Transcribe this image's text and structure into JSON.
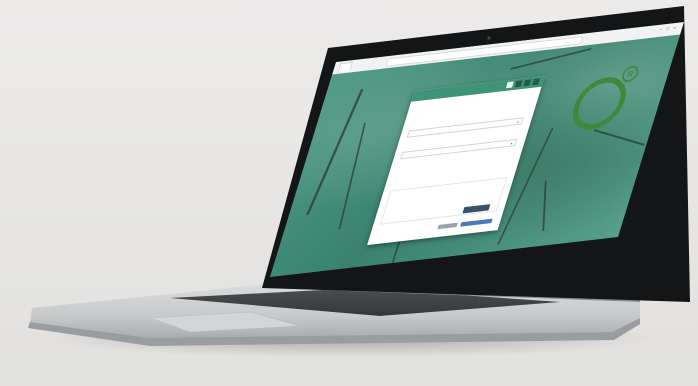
{
  "browser": {
    "tab_label": "",
    "url": ""
  },
  "colors": {
    "dialog_header": "#3f9478",
    "background_teal": "#3f8a78",
    "logo_green": "#3e8a3c",
    "pill_button": "#39506a"
  },
  "brand": {
    "logo_letter": "R"
  },
  "dialog": {
    "title": "",
    "header_title": "",
    "field1_label": "",
    "field1_value": "",
    "field2_label": "",
    "field2_value": "",
    "section_label": "",
    "section_value": "",
    "pill_label": ""
  },
  "map": {
    "side_label": ""
  }
}
